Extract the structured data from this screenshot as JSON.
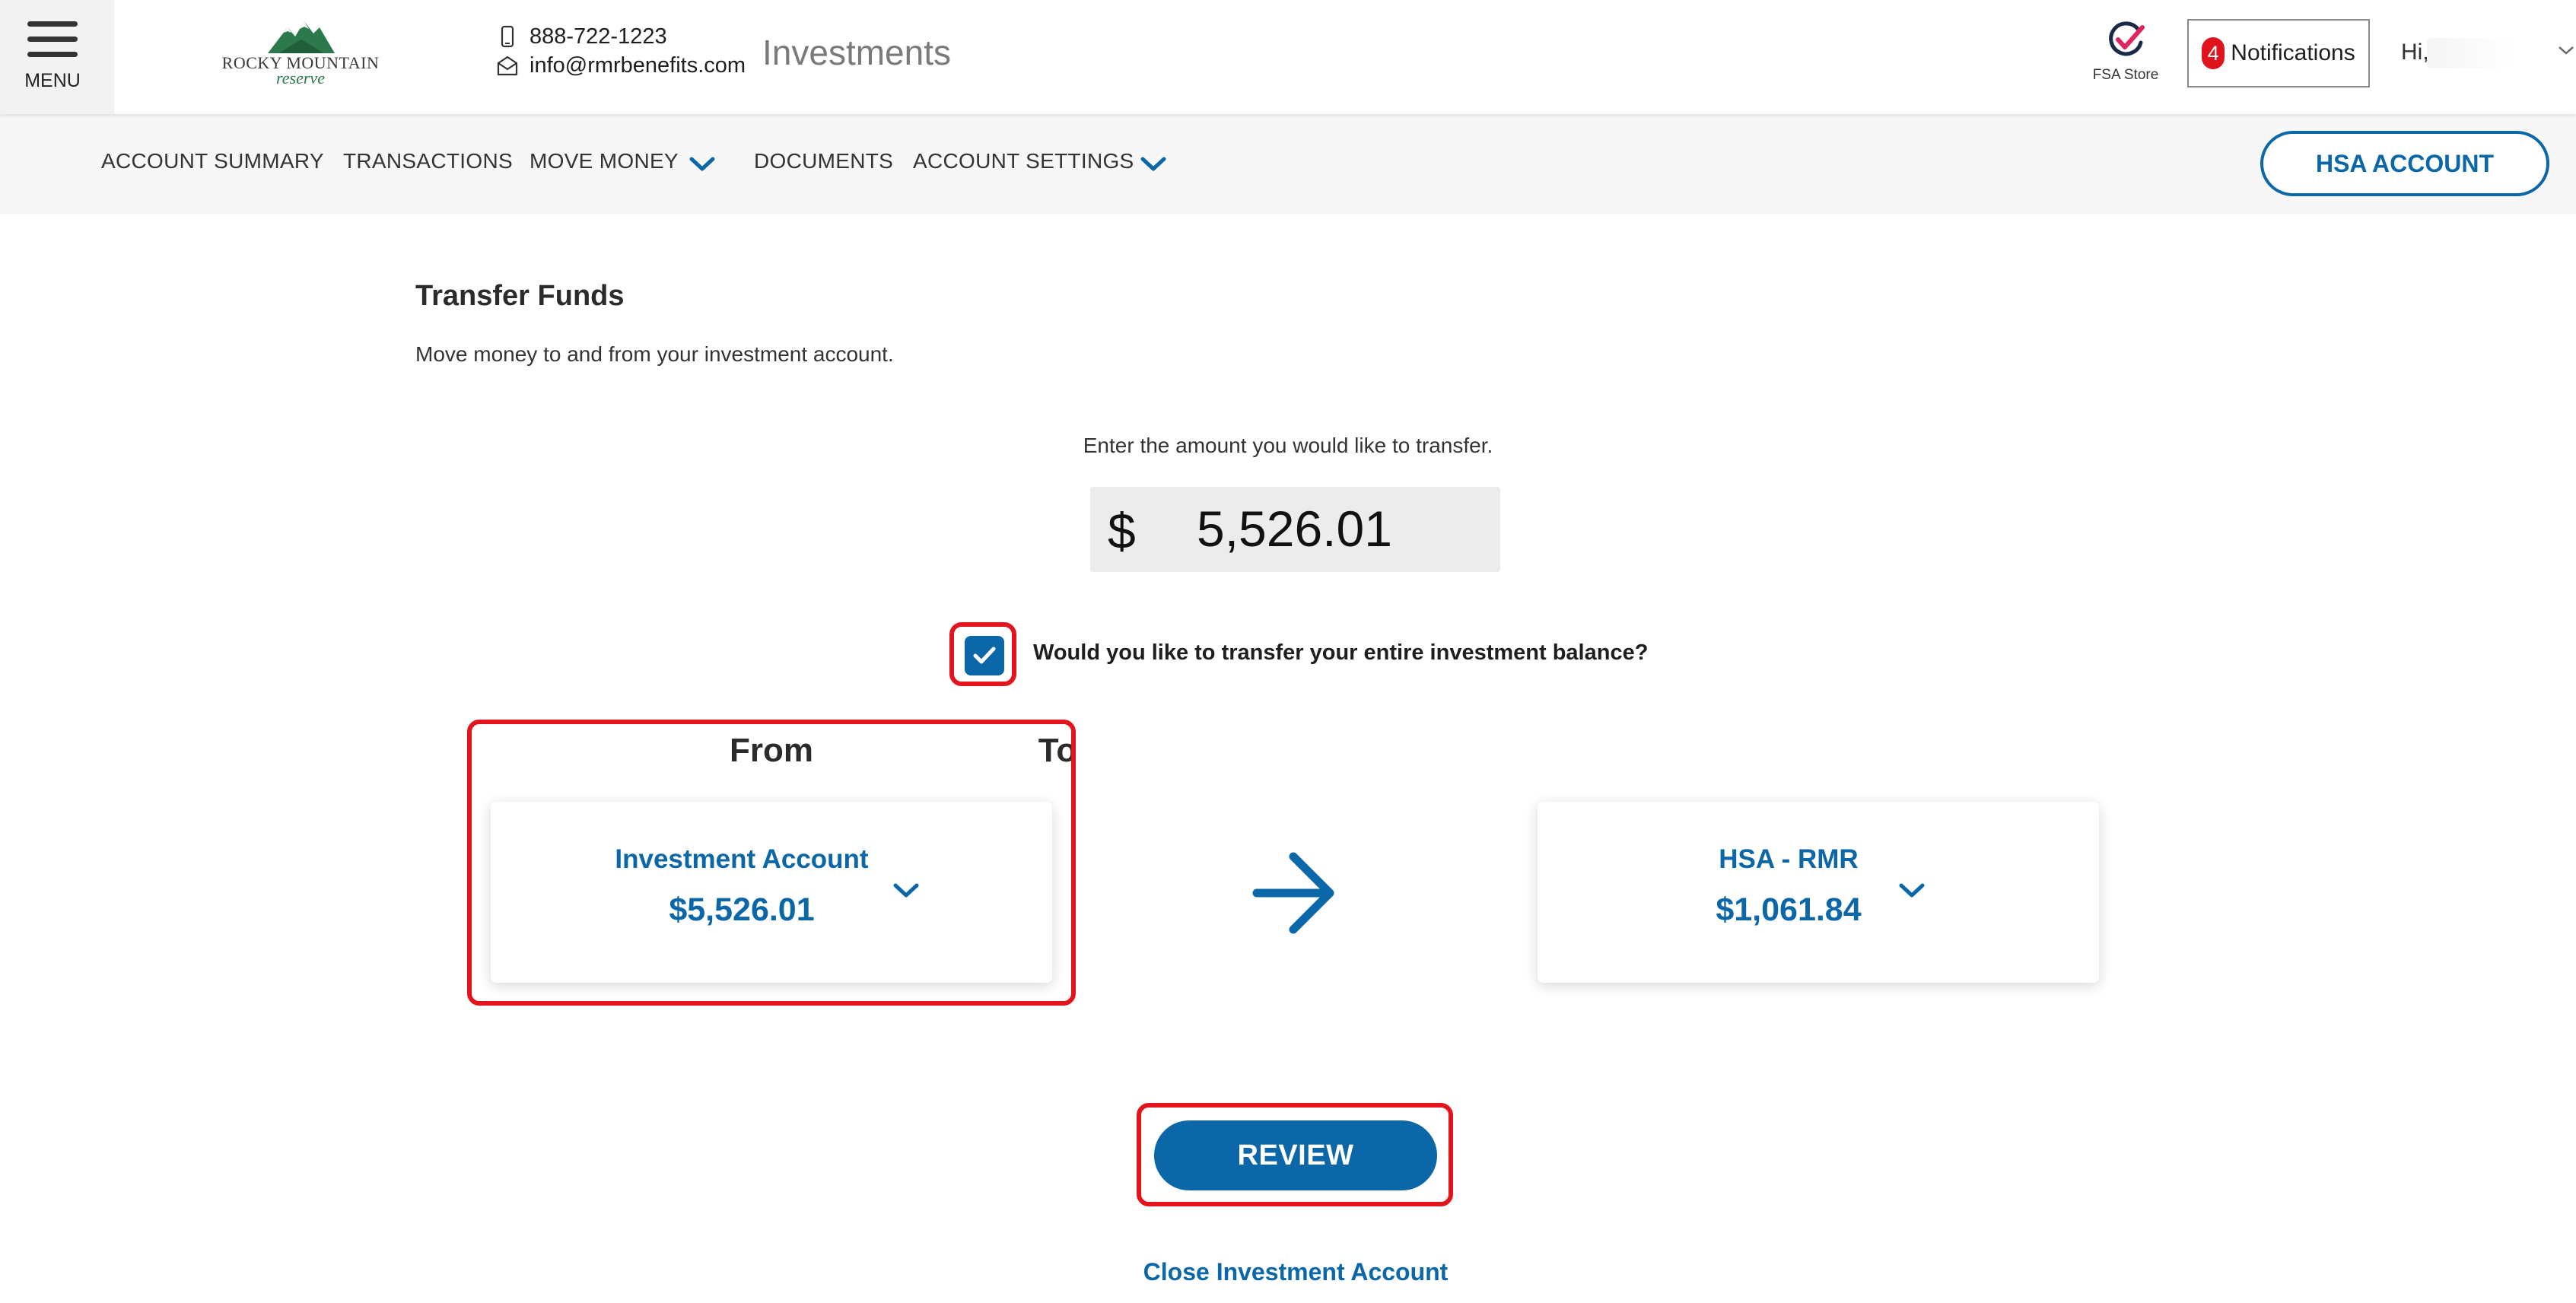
{
  "header": {
    "menu_label": "MENU",
    "logo": {
      "brand_text": "ROCKY MOUNTAIN",
      "script_text": "reserve"
    },
    "phone": "888-722-1223",
    "email": "info@rmrbenefits.com",
    "app_title": "Investments",
    "fsa_store_label": "FSA Store",
    "notifications": {
      "count": "4",
      "label": "Notifications"
    },
    "greeting": "Hi,"
  },
  "nav": {
    "items": [
      "ACCOUNT SUMMARY",
      "TRANSACTIONS",
      "MOVE MONEY",
      "DOCUMENTS",
      "ACCOUNT SETTINGS"
    ],
    "hsa_button": "HSA ACCOUNT"
  },
  "main": {
    "title": "Transfer Funds",
    "subtitle": "Move money to and from your investment account.",
    "amount_prompt": "Enter the amount you would like to transfer.",
    "currency_symbol": "$",
    "amount_value": "5,526.01",
    "entire_balance_label": "Would you like to transfer your entire investment balance?",
    "entire_balance_checked": true,
    "from": {
      "heading": "From",
      "account_name": "Investment Account",
      "balance": "$5,526.01"
    },
    "to": {
      "heading": "To",
      "account_name": "HSA - RMR",
      "balance": "$1,061.84"
    },
    "review_button": "REVIEW",
    "close_link": "Close Investment Account"
  },
  "colors": {
    "accent_blue": "#0b67a8",
    "highlight_red": "#e3141c",
    "badge_red": "#e0141c",
    "logo_green": "#2c7a4b",
    "nav_bg": "#f7f7f7"
  },
  "icons": {
    "menu": "hamburger-menu-icon",
    "phone": "phone-icon",
    "email": "envelope-icon",
    "fsa_store": "check-badge-icon",
    "dropdown": "chevron-down-icon",
    "checkbox": "checkmark-icon",
    "transfer_direction": "arrow-right-icon"
  }
}
